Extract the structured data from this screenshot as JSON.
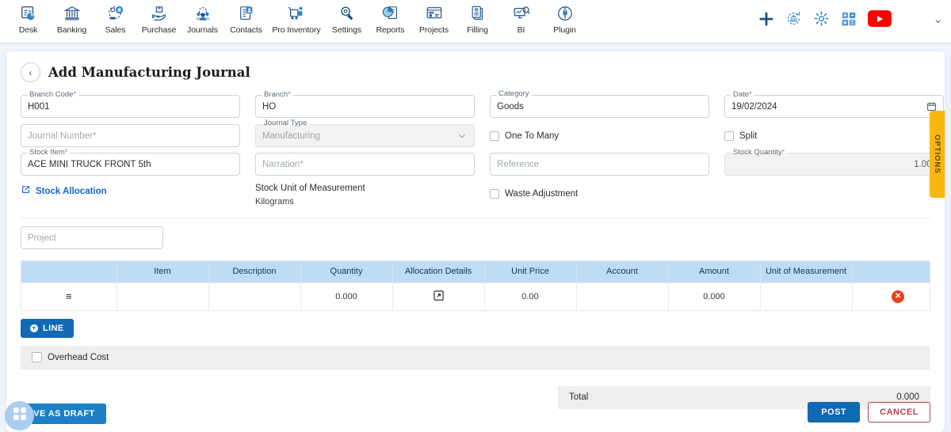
{
  "topnav": {
    "items": [
      {
        "label": "Desk",
        "icon": "desk-dashboard-icon"
      },
      {
        "label": "Banking",
        "icon": "bank-building-icon"
      },
      {
        "label": "Sales",
        "icon": "sales-tag-icon"
      },
      {
        "label": "Purchase",
        "icon": "purchase-hand-icon"
      },
      {
        "label": "Journals",
        "icon": "journals-people-icon"
      },
      {
        "label": "Contacts",
        "icon": "contacts-card-icon"
      },
      {
        "label": "Pro Inventory",
        "icon": "inventory-cart-icon"
      },
      {
        "label": "Settings",
        "icon": "settings-tools-icon"
      },
      {
        "label": "Reports",
        "icon": "reports-piechart-icon"
      },
      {
        "label": "Projects",
        "icon": "projects-board-icon"
      },
      {
        "label": "Filling",
        "icon": "filling-documents-icon"
      },
      {
        "label": "BI",
        "icon": "bi-monitor-icon"
      },
      {
        "label": "Plugin",
        "icon": "plugin-plug-icon"
      }
    ],
    "right_icons": [
      {
        "name": "add-plus-icon"
      },
      {
        "name": "refresh-bank-icon"
      },
      {
        "name": "gear-icon"
      },
      {
        "name": "calculator-icon"
      },
      {
        "name": "youtube-icon"
      }
    ],
    "chevron": "⌄"
  },
  "page": {
    "back": "‹",
    "title": "Add Manufacturing Journal",
    "options_tab": "OPTIONS"
  },
  "form": {
    "branch_code": {
      "label": "Branch Code",
      "required": "*",
      "value": "H001"
    },
    "branch": {
      "label": "Branch",
      "required": "*",
      "value": "HO"
    },
    "category": {
      "label": "Category",
      "required": "",
      "value": "Goods"
    },
    "date": {
      "label": "Date",
      "required": "*",
      "value": "19/02/2024",
      "icon": "calendar-icon"
    },
    "journal_number": {
      "placeholder": "Journal Number",
      "required": "*",
      "value": ""
    },
    "journal_type": {
      "label": "Journal Type",
      "value": "Manufacturing",
      "icon": "chevron-down-icon"
    },
    "one_to_many": {
      "label": "One To Many",
      "checked": false
    },
    "split": {
      "label": "Split",
      "checked": false
    },
    "stock_item": {
      "label": "Stock Item",
      "required": "*",
      "value": "ACE MINI TRUCK FRONT 5th"
    },
    "narration": {
      "placeholder": "Narration",
      "required": "*",
      "value": ""
    },
    "reference": {
      "placeholder": "Reference",
      "value": ""
    },
    "stock_quantity": {
      "label": "Stock Quantity",
      "required": "*",
      "value": "1.000"
    },
    "stock_allocation": {
      "label": "Stock Allocation",
      "icon": "external-link-icon"
    },
    "stock_uom": {
      "label": "Stock Unit of Measurement",
      "value": "Kilograms"
    },
    "waste_adjustment": {
      "label": "Waste Adjustment",
      "checked": false
    },
    "project": {
      "placeholder": "Project",
      "value": ""
    }
  },
  "table": {
    "columns": [
      "",
      "Item",
      "Description",
      "Quantity",
      "Allocation Details",
      "Unit Price",
      "Account",
      "Amount",
      "Unit of Measurement",
      ""
    ],
    "rows": [
      {
        "handle": "≡",
        "item": "",
        "description": "",
        "quantity": "0.000",
        "allocation_icon": "external-link-icon",
        "unit_price": "0.00",
        "account": "",
        "amount": "0.000",
        "uom": "",
        "delete_icon": "delete-circle-icon"
      }
    ]
  },
  "actions": {
    "line_button": "LINE",
    "overhead_cost": "Overhead Cost",
    "total_label": "Total",
    "total_value": "0.000",
    "post": "POST",
    "cancel": "CANCEL",
    "save_as_draft": "SAVE AS DRAFT",
    "fab_icon": "apps-grid-icon"
  },
  "colors": {
    "primary_blue": "#1168b3",
    "table_header": "#bfdcf5",
    "options_yellow": "#fbb611",
    "cancel_red": "#b0404a",
    "delete_red": "#e8401c",
    "youtube_red": "#ff0000"
  }
}
